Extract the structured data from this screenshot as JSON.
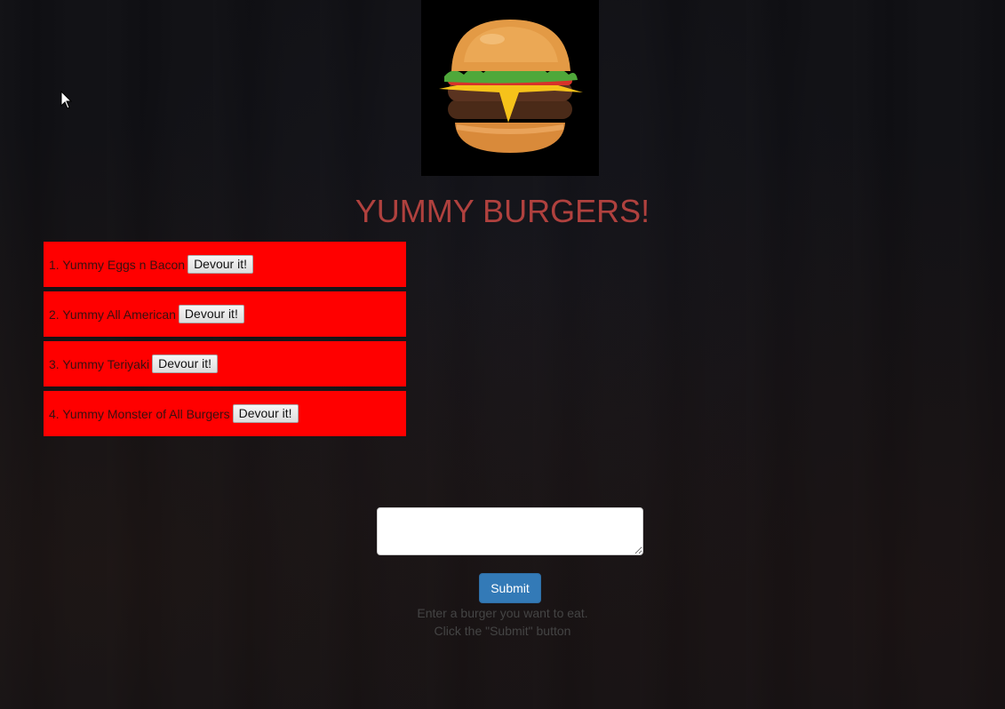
{
  "header": {
    "title": "YUMMY BURGERS!"
  },
  "burgers": [
    {
      "label": "1. Yummy Eggs n Bacon",
      "button": "Devour it!"
    },
    {
      "label": "2. Yummy All American",
      "button": "Devour it!"
    },
    {
      "label": "3. Yummy Teriyaki",
      "button": "Devour it!"
    },
    {
      "label": "4. Yummy Monster of All Burgers",
      "button": "Devour it!"
    }
  ],
  "form": {
    "textarea_value": "",
    "submit_label": "Submit",
    "instruction_line_1": "Enter a burger you want to eat.",
    "instruction_line_2": "Click the \"Submit\" button"
  },
  "colors": {
    "title": "#b0413e",
    "item_background": "#ff0000",
    "submit_button": "#337ab7",
    "page_background": "#0f0f13"
  },
  "icons": {
    "logo": "burger-logo-icon",
    "cursor": "mouse-pointer-icon"
  }
}
